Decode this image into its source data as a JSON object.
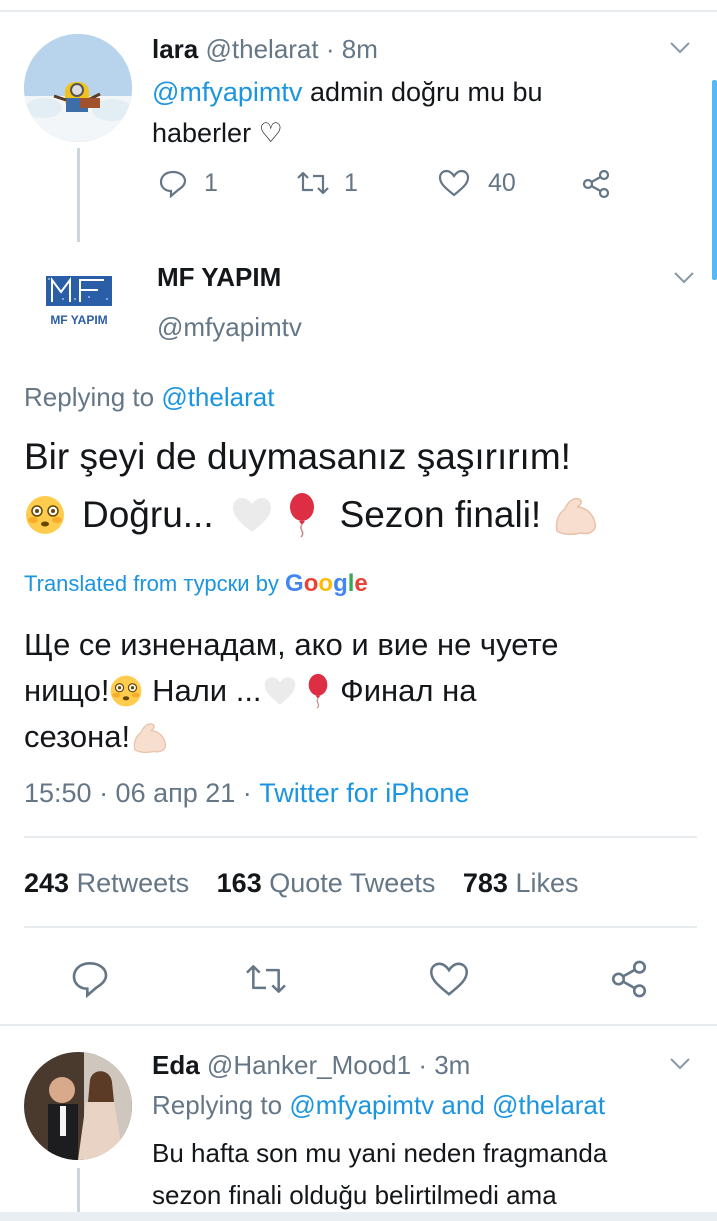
{
  "tweet1": {
    "name": "lara",
    "handle": "@thelarat",
    "time": "· 8m",
    "mention": "@mfyapimtv",
    "text_line1": " admin doğru mu bu",
    "text_line2": "haberler ♡",
    "replies": "1",
    "retweets": "1",
    "likes": "40"
  },
  "main_tweet": {
    "logo_text": "MF YAPIM",
    "name": "MF YAPIM",
    "handle": "@mfyapimtv",
    "replying_label": "Replying to ",
    "replying_handle": "@thelarat",
    "text_line1": "Bir şeyi de duymasanız şaşırırım!",
    "text_line2a": "Doğru...",
    "text_line2b": "Sezon finali!",
    "translated_label": "Translated from турски by ",
    "google": [
      "G",
      "o",
      "o",
      "g",
      "l",
      "e"
    ],
    "translation_line1": "Ще се изненадам, ако и вие не чуете",
    "translation_line2a": "нищо!",
    "translation_line2b": " Нали ...",
    "translation_line2c": " Финал на",
    "translation_line3": "сезона!",
    "timestamp": "15:50 · 06 апр 21 · ",
    "source": "Twitter for iPhone",
    "retweets_count": "243",
    "retweets_label": "Retweets",
    "quotes_count": "163",
    "quotes_label": "Quote Tweets",
    "likes_count": "783",
    "likes_label": "Likes"
  },
  "tweet3": {
    "name": "Eda",
    "handle": "@Hanker_Mood1",
    "time": "· 3m",
    "replying_label": "Replying to ",
    "replying_handle1": "@mfyapimtv",
    "replying_and": " and ",
    "replying_handle2": "@thelarat",
    "text_line1": "Bu hafta son mu yani neden fragmanda",
    "text_line2": "sezon finali olduğu belirtilmedi ama"
  },
  "colors": {
    "accent": "#1b95e0",
    "gray": "#657786",
    "divider": "#e6ecf0"
  }
}
